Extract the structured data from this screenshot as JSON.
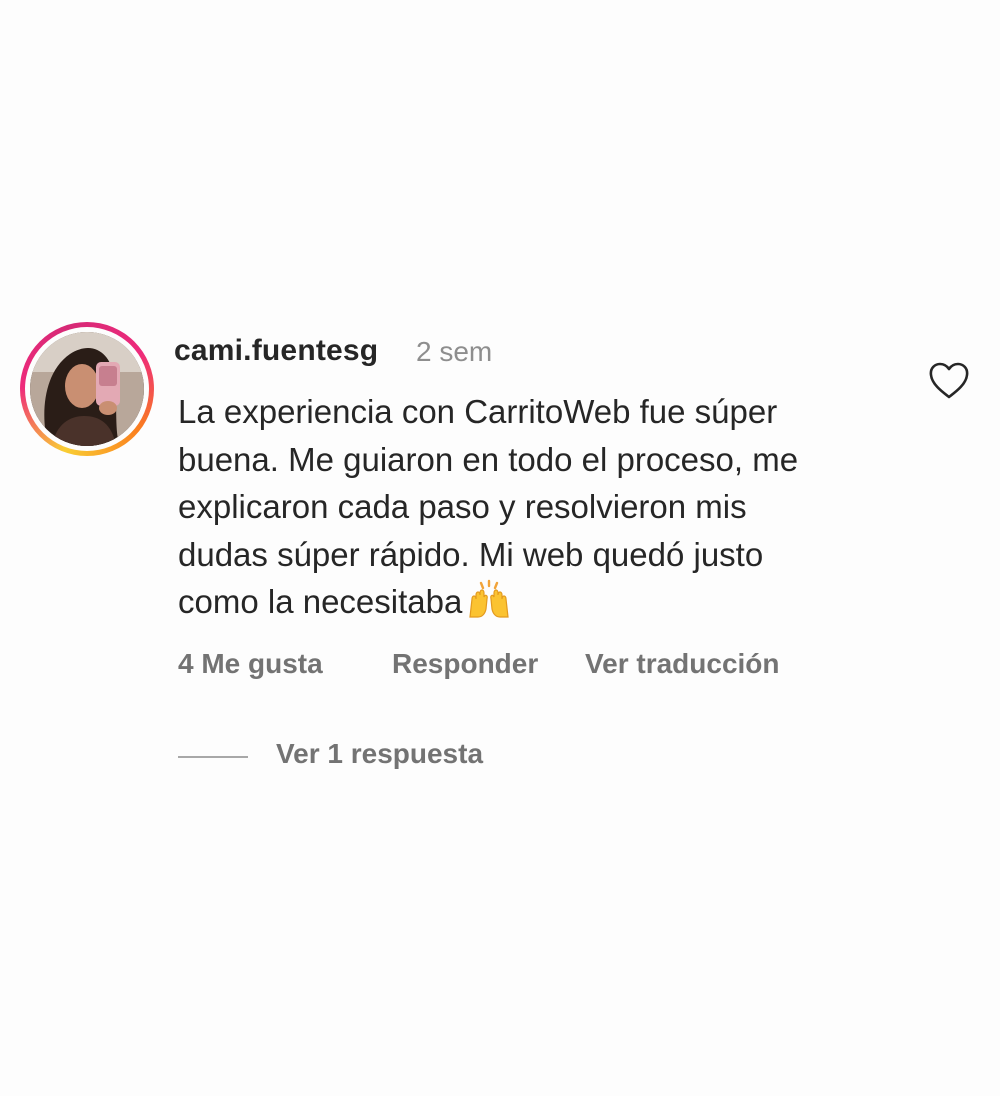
{
  "comment": {
    "username": "cami.fuentesg",
    "time": "2 sem",
    "text_lines": [
      "La experiencia con CarritoWeb fue súper",
      "buena. Me guiaron en todo el proceso, me",
      "explicaron cada paso y resolvieron mis",
      "dudas súper rápido. Mi web quedó justo",
      "como la necesitaba"
    ],
    "emoji": "raising-hands-emoji",
    "like_icon": "heart-outline-icon",
    "actions": {
      "likes": "4 Me gusta",
      "reply": "Responder",
      "translate": "Ver traducción"
    },
    "view_replies": "Ver 1 respuesta"
  },
  "colors": {
    "background": "#fdfdfd",
    "text_primary": "#262626",
    "text_secondary": "#737373",
    "timestamp": "#8e8e8e",
    "story_ring": [
      "#f9ce34",
      "#ee2a7b",
      "#fa7e1e"
    ]
  }
}
